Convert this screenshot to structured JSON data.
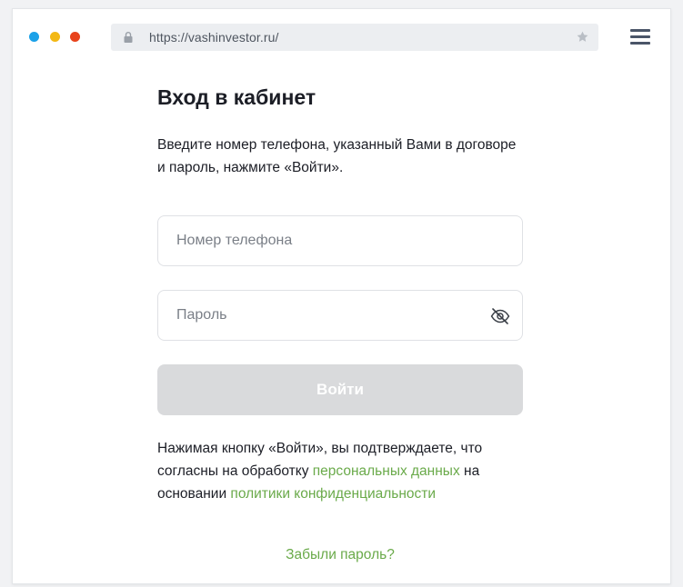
{
  "browser": {
    "url": "https://vashinvestor.ru/",
    "traffic_lights": [
      "#1ba1e8",
      "#f3b814",
      "#e8431c"
    ]
  },
  "login": {
    "title": "Вход в кабинет",
    "intro": "Введите номер телефона, указанный Вами в договоре и пароль, нажмите «Войти».",
    "phone_placeholder": "Номер телефона",
    "password_placeholder": "Пароль",
    "password_toggle_icon": "eye-off-icon",
    "submit_label": "Войти",
    "consent_prefix": "Нажимая кнопку «Войти», вы подтверждаете, что согласны на обработку ",
    "consent_link_personal": "персональных данных",
    "consent_middle": " на основании ",
    "consent_link_policy": "политики конфиденциальности",
    "forgot_label": "Забыли пароль?"
  },
  "colors": {
    "link": "#6aaa4a",
    "button_disabled": "#d9dadc",
    "text": "#1c1e26"
  }
}
